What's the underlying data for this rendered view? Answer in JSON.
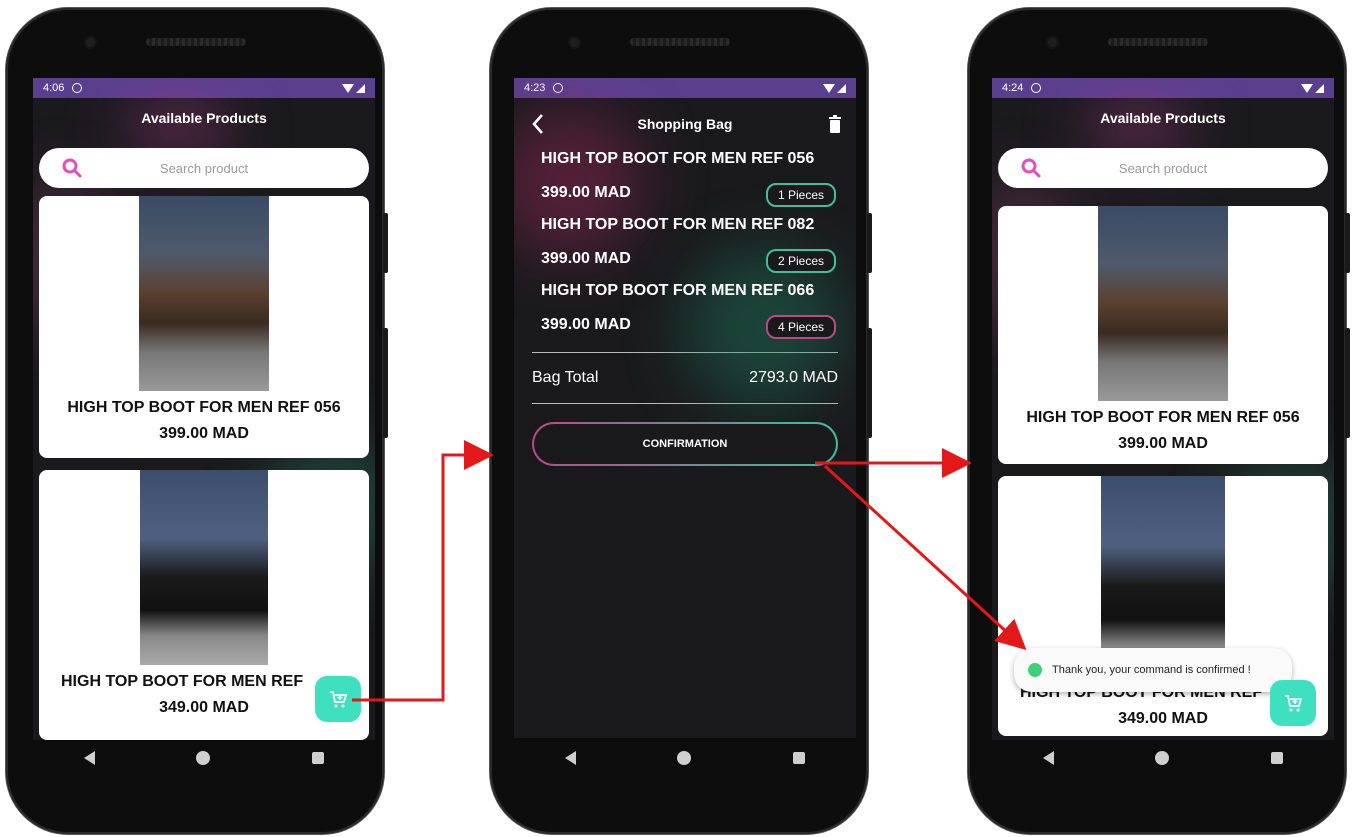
{
  "screen1": {
    "status_time": "4:06",
    "title": "Available Products",
    "search_placeholder": "Search product",
    "products": [
      {
        "name": "HIGH TOP BOOT FOR MEN REF 056",
        "price": "399.00 MAD"
      },
      {
        "name": "HIGH TOP BOOT FOR MEN REF",
        "price": "349.00 MAD"
      }
    ]
  },
  "screen2": {
    "status_time": "4:23",
    "title": "Shopping Bag",
    "items": [
      {
        "name": "HIGH TOP BOOT FOR MEN REF 056",
        "price": "399.00 MAD",
        "qty": "1  Pieces"
      },
      {
        "name": "HIGH TOP BOOT FOR MEN REF 082",
        "price": "399.00 MAD",
        "qty": "2  Pieces"
      },
      {
        "name": "HIGH TOP BOOT FOR MEN REF 066",
        "price": "399.00 MAD",
        "qty": "4  Pieces"
      }
    ],
    "total_label": "Bag Total",
    "total_value": "2793.0 MAD",
    "confirm_label": "CONFIRMATION"
  },
  "screen3": {
    "status_time": "4:24",
    "title": "Available Products",
    "search_placeholder": "Search product",
    "products": [
      {
        "name": "HIGH TOP BOOT FOR MEN REF 056",
        "price": "399.00 MAD"
      },
      {
        "name": "HIGH TOP BOOT FOR MEN REF",
        "price": "349.00 MAD"
      }
    ],
    "toast": "Thank you, your command is confirmed !"
  },
  "colors": {
    "statusbar": "#5a3f8f",
    "fab": "#3fe0c0",
    "arrow": "#e31818",
    "screen_bg": "#1a1a1c"
  },
  "icons": [
    "search-icon",
    "cart-add-icon",
    "back-arrow-icon",
    "trash-icon",
    "android-icon",
    "wifi-icon",
    "signal-icon"
  ]
}
